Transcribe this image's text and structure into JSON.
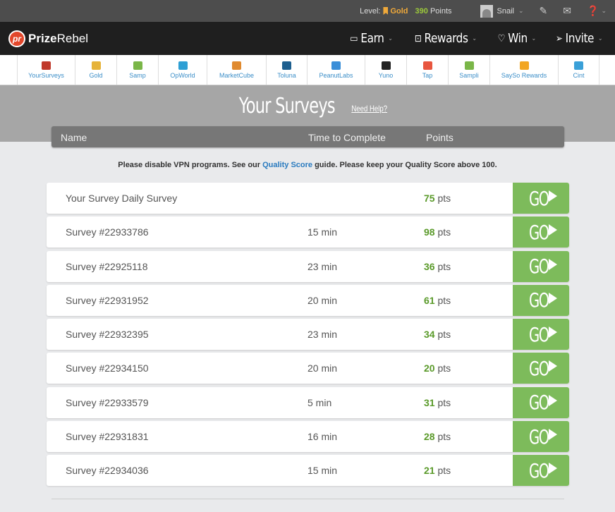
{
  "topbar": {
    "level_label": "Level:",
    "level": "Gold",
    "points": "390",
    "points_label": "Points",
    "username": "Snail"
  },
  "nav": {
    "logo_bold": "Prize",
    "logo_rest": "Rebel",
    "items": [
      {
        "label": "Earn"
      },
      {
        "label": "Rewards"
      },
      {
        "label": "Win"
      },
      {
        "label": "Invite"
      }
    ]
  },
  "providers": [
    {
      "label": "YourSurveys",
      "color": "#c0392b"
    },
    {
      "label": "Gold",
      "color": "#e6b33a"
    },
    {
      "label": "Samp",
      "color": "#7ab648"
    },
    {
      "label": "OpWorld",
      "color": "#2e9fd4"
    },
    {
      "label": "MarketCube",
      "color": "#e08a2f"
    },
    {
      "label": "Toluna",
      "color": "#1d5f8f"
    },
    {
      "label": "PeanutLabs",
      "color": "#3a8ed8"
    },
    {
      "label": "Yuno",
      "color": "#222222"
    },
    {
      "label": "Tap",
      "color": "#e8563f"
    },
    {
      "label": "Sampli",
      "color": "#7ab648"
    },
    {
      "label": "SaySo Rewards",
      "color": "#f2a623"
    },
    {
      "label": "Cint",
      "color": "#3aa0d8"
    }
  ],
  "hero": {
    "title": "Your Surveys",
    "help": "Need Help?"
  },
  "table_header": {
    "name": "Name",
    "time": "Time to Complete",
    "points": "Points"
  },
  "notice": {
    "before": "Please disable VPN programs. See our ",
    "link": "Quality Score",
    "after": " guide. Please keep your Quality Score above 100."
  },
  "go_label": "GO",
  "pts_unit": "pts",
  "surveys": [
    {
      "name": "Your Survey Daily Survey",
      "time": "",
      "points": "75"
    },
    {
      "name": "Survey #22933786",
      "time": "15 min",
      "points": "98"
    },
    {
      "name": "Survey #22925118",
      "time": "23 min",
      "points": "36"
    },
    {
      "name": "Survey #22931952",
      "time": "20 min",
      "points": "61"
    },
    {
      "name": "Survey #22932395",
      "time": "23 min",
      "points": "34"
    },
    {
      "name": "Survey #22934150",
      "time": "20 min",
      "points": "20"
    },
    {
      "name": "Survey #22933579",
      "time": "5 min",
      "points": "31"
    },
    {
      "name": "Survey #22931831",
      "time": "16 min",
      "points": "28"
    },
    {
      "name": "Survey #22934036",
      "time": "15 min",
      "points": "21"
    }
  ]
}
